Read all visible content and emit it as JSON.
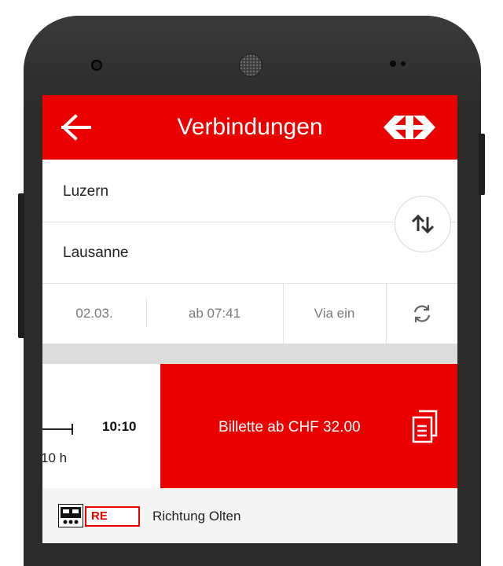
{
  "header": {
    "title": "Verbindungen",
    "back_icon": "arrow-left-icon",
    "logo_icon": "sbb-logo-icon"
  },
  "search": {
    "from": "Luzern",
    "to": "Lausanne",
    "swap_icon": "swap-direction-icon"
  },
  "options": {
    "date": "02.03.",
    "time": "ab 07:41",
    "via": "Via ein",
    "refresh_icon": "refresh-icon"
  },
  "connection": {
    "arrival": "10:10",
    "duration": "10 h",
    "ticket_label": "Billette ab CHF 32.00",
    "ticket_icon": "ticket-copy-icon"
  },
  "train": {
    "type_icon": "train-icon",
    "badge": "RE",
    "direction": "Richtung Olten"
  },
  "colors": {
    "brand_red": "#eb0000",
    "phone_body": "#2b2b2b"
  }
}
